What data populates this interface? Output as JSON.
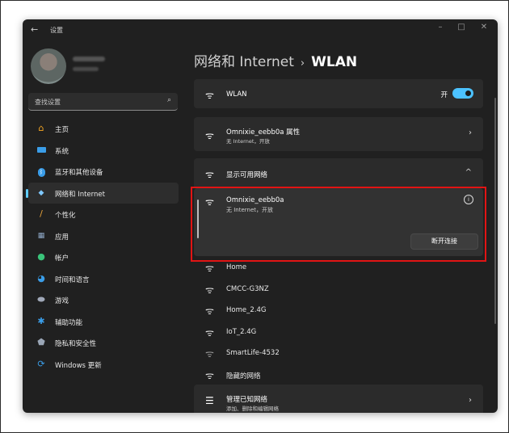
{
  "window": {
    "title": "设置",
    "back_glyph": "←",
    "minimize": "–",
    "maximize": "□",
    "close": "✕"
  },
  "search": {
    "placeholder": "查找设置",
    "icon": "search-icon"
  },
  "sidebar": {
    "items": [
      {
        "label": "主页",
        "icon": "home-icon",
        "color": "#f5a623"
      },
      {
        "label": "系统",
        "icon": "monitor-icon",
        "color": "#3a9de8"
      },
      {
        "label": "蓝牙和其他设备",
        "icon": "bluetooth-icon",
        "color": "#3a9de8"
      },
      {
        "label": "网络和 Internet",
        "icon": "wifi-icon",
        "color": "#7fc8ff",
        "active": true
      },
      {
        "label": "个性化",
        "icon": "brush-icon",
        "color": "#e8a33a"
      },
      {
        "label": "应用",
        "icon": "apps-icon",
        "color": "#8fa9c8"
      },
      {
        "label": "帐户",
        "icon": "account-icon",
        "color": "#3ac47a"
      },
      {
        "label": "时间和语言",
        "icon": "globe-clock-icon",
        "color": "#3a9de8"
      },
      {
        "label": "游戏",
        "icon": "gamepad-icon",
        "color": "#a0a8b8"
      },
      {
        "label": "辅助功能",
        "icon": "accessibility-icon",
        "color": "#3a9de8"
      },
      {
        "label": "隐私和安全性",
        "icon": "shield-icon",
        "color": "#9aa6b6"
      },
      {
        "label": "Windows 更新",
        "icon": "update-icon",
        "color": "#3a9de8"
      }
    ]
  },
  "header": {
    "crumb1": "网络和 Internet",
    "separator": "›",
    "crumb2": "WLAN"
  },
  "wlan_card": {
    "label": "WLAN",
    "toggle_label": "开",
    "toggle_on": true,
    "accent": "#4cc2ff"
  },
  "current_card": {
    "name": "Omnixie_eebb0a 属性",
    "status": "无 Internet，开放"
  },
  "available": {
    "label": "显示可用网络",
    "chevron": "^"
  },
  "expanded_network": {
    "name": "Omnixie_eebb0a",
    "status": "无 Internet，开放",
    "info": "i",
    "disconnect_label": "断开连接"
  },
  "networks": [
    {
      "name": "Home"
    },
    {
      "name": "CMCC-G3NZ"
    },
    {
      "name": "Home_2.4G"
    },
    {
      "name": "IoT_2.4G"
    },
    {
      "name": "SmartLife-4532"
    },
    {
      "name": "隐藏的网络"
    }
  ],
  "manage": {
    "title": "管理已知网络",
    "subtitle": "添加、删除和编辑网络"
  },
  "highlight_color": "#e21414"
}
